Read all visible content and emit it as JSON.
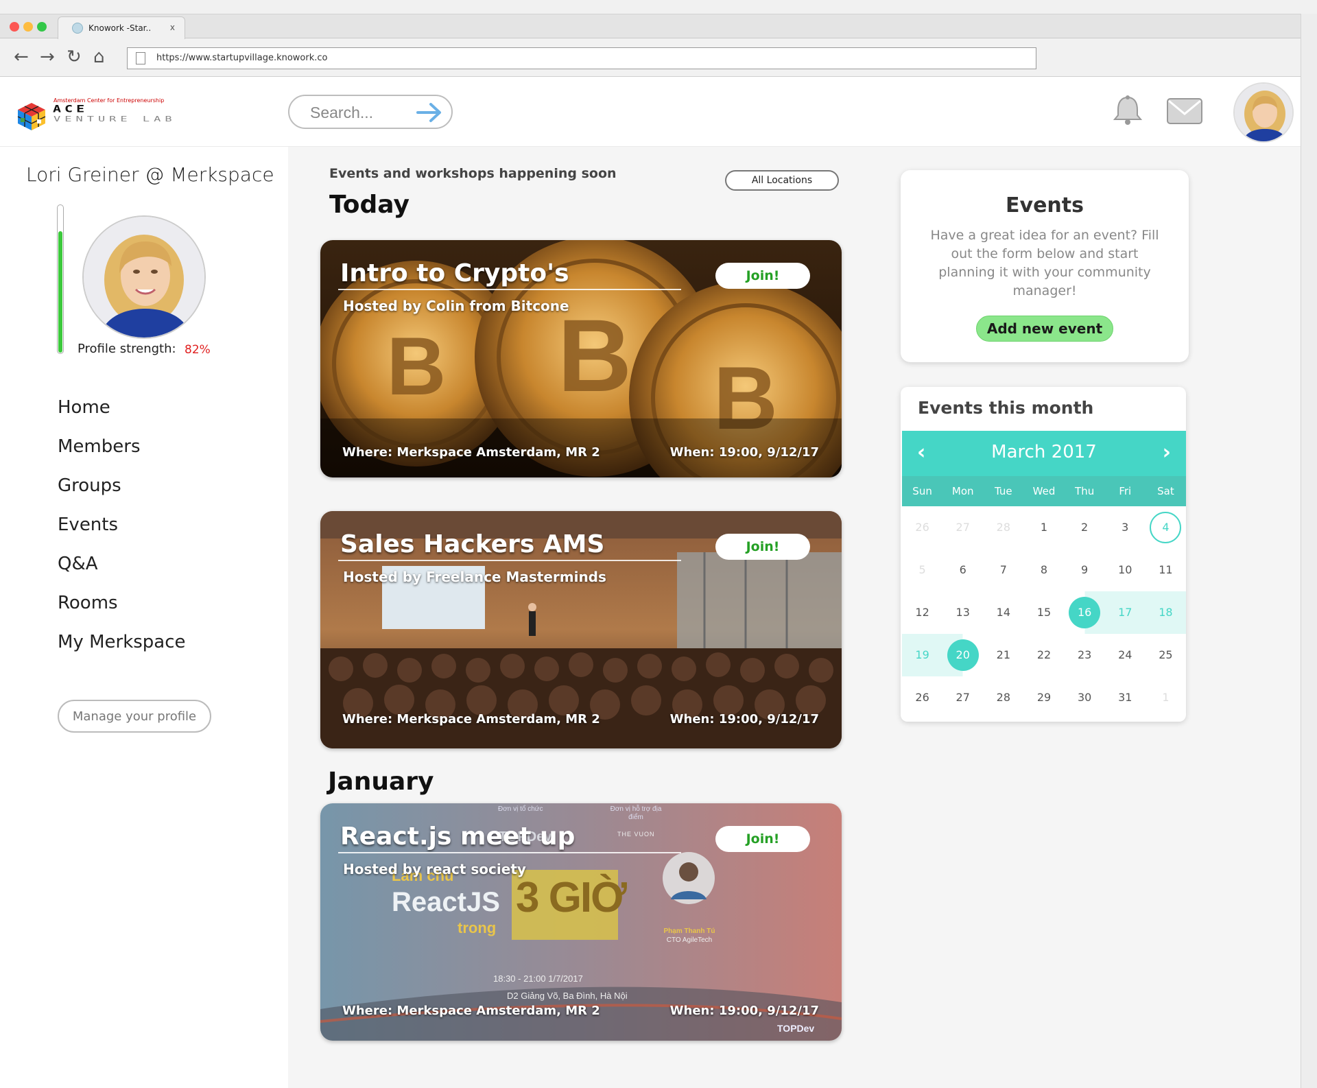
{
  "browser": {
    "tab_title": "Knowork -Star..",
    "tab_close": "x",
    "url": "https://www.startupvillage.knowork.co"
  },
  "header": {
    "logo_small": "Amsterdam Center for Entrepreneurship",
    "logo_ace": "ACE",
    "logo_sub": "VENTURE LAB",
    "search_placeholder": "Search..."
  },
  "profile": {
    "title": "Lori Greiner @ Merkspace",
    "strength_label": "Profile strength:",
    "strength_value": "82%",
    "strength_fraction": 0.82,
    "manage_label": "Manage your profile"
  },
  "nav": {
    "items": [
      "Home",
      "Members",
      "Groups",
      "Events",
      "Q&A",
      "Rooms",
      "My Merkspace"
    ]
  },
  "main": {
    "subtitle": "Events and workshops happening soon",
    "location_filter": "All Locations",
    "section_today": "Today",
    "section_january": "January",
    "join_label": "Join!",
    "cards": [
      {
        "title": "Intro to Crypto's",
        "host": "Hosted by Colin from Bitcone",
        "where": "Where: Merkspace Amsterdam, MR 2",
        "when": "When: 19:00, 9/12/17"
      },
      {
        "title": "Sales Hackers AMS",
        "host": "Hosted by Freelance Masterminds",
        "where": "Where: Merkspace Amsterdam, MR 2",
        "when": "When: 19:00, 9/12/17"
      },
      {
        "title": "React.js meet up",
        "host": "Hosted by react society",
        "where": "Where: Merkspace Amsterdam, MR 2",
        "when": "When: 19:00, 9/12/17"
      }
    ],
    "poster": {
      "organizer_label": "Đơn vị tổ chức",
      "venue_label": "Đơn vị hỗ trợ địa điểm",
      "brand": "TOPDev",
      "venue_brand": "THE VUON",
      "line1": "Làm chủ",
      "line2": "ReactJS",
      "line3": "trong",
      "big": "3 GIỜ",
      "speaker": "Phạm Thanh Tú",
      "speaker_role": "CTO AgileTech",
      "time": "18:30 - 21:00 1/7/2017",
      "address": "D2 Giảng Võ, Ba Đình, Hà Nội"
    }
  },
  "right": {
    "events_title": "Events",
    "events_text": "Have a great idea for an event? Fill out the form below and start planning it with your community manager!",
    "add_label": "Add new event",
    "calendar_title": "Events this month",
    "calendar_month": "March 2017",
    "weekdays": [
      "Sun",
      "Mon",
      "Tue",
      "Wed",
      "Thu",
      "Fri",
      "Sat"
    ],
    "weeks": [
      [
        "26",
        "27",
        "28",
        "1",
        "2",
        "3",
        "4"
      ],
      [
        "5",
        "6",
        "7",
        "8",
        "9",
        "10",
        "11"
      ],
      [
        "12",
        "13",
        "14",
        "15",
        "16",
        "17",
        "18"
      ],
      [
        "19",
        "20",
        "21",
        "22",
        "23",
        "24",
        "25"
      ],
      [
        "26",
        "27",
        "28",
        "29",
        "30",
        "31",
        "1"
      ]
    ]
  },
  "colors": {
    "accent": "#45d6c6",
    "join_text": "#25a025",
    "add_button": "#8be68b",
    "strength": "#3cc93c",
    "strength_value": "#e02020"
  }
}
